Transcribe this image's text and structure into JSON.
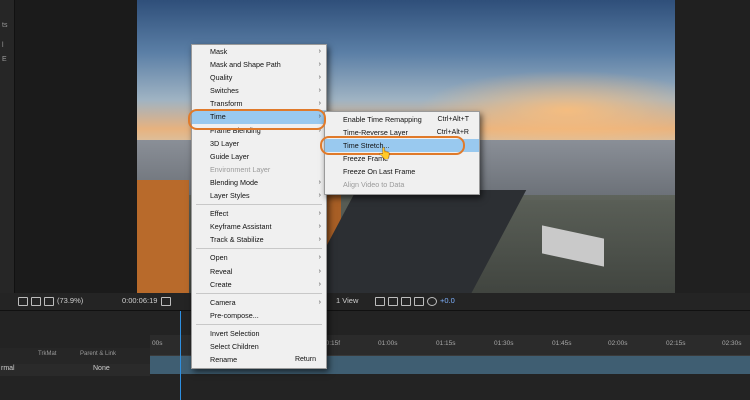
{
  "left_strip": {
    "labels": [
      "ts",
      "l",
      "E"
    ]
  },
  "viewer_toolbar": {
    "zoom": "(73.9%)",
    "timecode": "0:00:06:19",
    "view": "1 View",
    "offset": "+0.0"
  },
  "timeline": {
    "column_headers": {
      "mode": "TrkMat",
      "parent": "Parent & Link"
    },
    "row": {
      "label_left": "rmal",
      "parent_value": "None"
    },
    "ruler_ticks": [
      "00s",
      "00:15f",
      "01:00s",
      "01:15s",
      "01:30s",
      "01:45s",
      "02:00s",
      "02:15s",
      "02:30s"
    ]
  },
  "context_menu": {
    "items": [
      {
        "label": "Mask",
        "submenu": true
      },
      {
        "label": "Mask and Shape Path",
        "submenu": true
      },
      {
        "label": "Quality",
        "submenu": true
      },
      {
        "label": "Switches",
        "submenu": true
      },
      {
        "label": "Transform",
        "submenu": true
      },
      {
        "label": "Time",
        "submenu": true,
        "highlighted": true
      },
      {
        "label": "Frame Blending",
        "submenu": true
      },
      {
        "label": "3D Layer",
        "submenu": false
      },
      {
        "label": "Guide Layer",
        "submenu": false
      },
      {
        "label": "Environment Layer",
        "submenu": false,
        "disabled": true
      },
      {
        "label": "Blending Mode",
        "submenu": true
      },
      {
        "label": "Layer Styles",
        "submenu": true
      },
      {
        "separator": true
      },
      {
        "label": "Effect",
        "submenu": true
      },
      {
        "label": "Keyframe Assistant",
        "submenu": true
      },
      {
        "label": "Track & Stabilize",
        "submenu": true
      },
      {
        "separator": true
      },
      {
        "label": "Open",
        "submenu": true
      },
      {
        "label": "Reveal",
        "submenu": true
      },
      {
        "label": "Create",
        "submenu": true
      },
      {
        "separator": true
      },
      {
        "label": "Camera",
        "submenu": true
      },
      {
        "label": "Pre-compose...",
        "submenu": false
      },
      {
        "separator": true
      },
      {
        "label": "Invert Selection",
        "submenu": false
      },
      {
        "label": "Select Children",
        "submenu": false
      },
      {
        "label": "Rename",
        "submenu": false,
        "shortcut": "Return"
      }
    ]
  },
  "time_submenu": {
    "items": [
      {
        "label": "Enable Time Remapping",
        "shortcut": "Ctrl+Alt+T"
      },
      {
        "label": "Time-Reverse Layer",
        "shortcut": "Ctrl+Alt+R"
      },
      {
        "label": "Time Stretch...",
        "highlighted": true
      },
      {
        "label": "Freeze Frame"
      },
      {
        "label": "Freeze On Last Frame"
      },
      {
        "label": "Align Video to Data",
        "disabled": true
      }
    ]
  },
  "colors": {
    "highlight": "#99c9ef",
    "annotation_ring": "#e07a2a",
    "menu_bg": "#f0f0f0",
    "timeline_accent": "#2e8fe0"
  }
}
